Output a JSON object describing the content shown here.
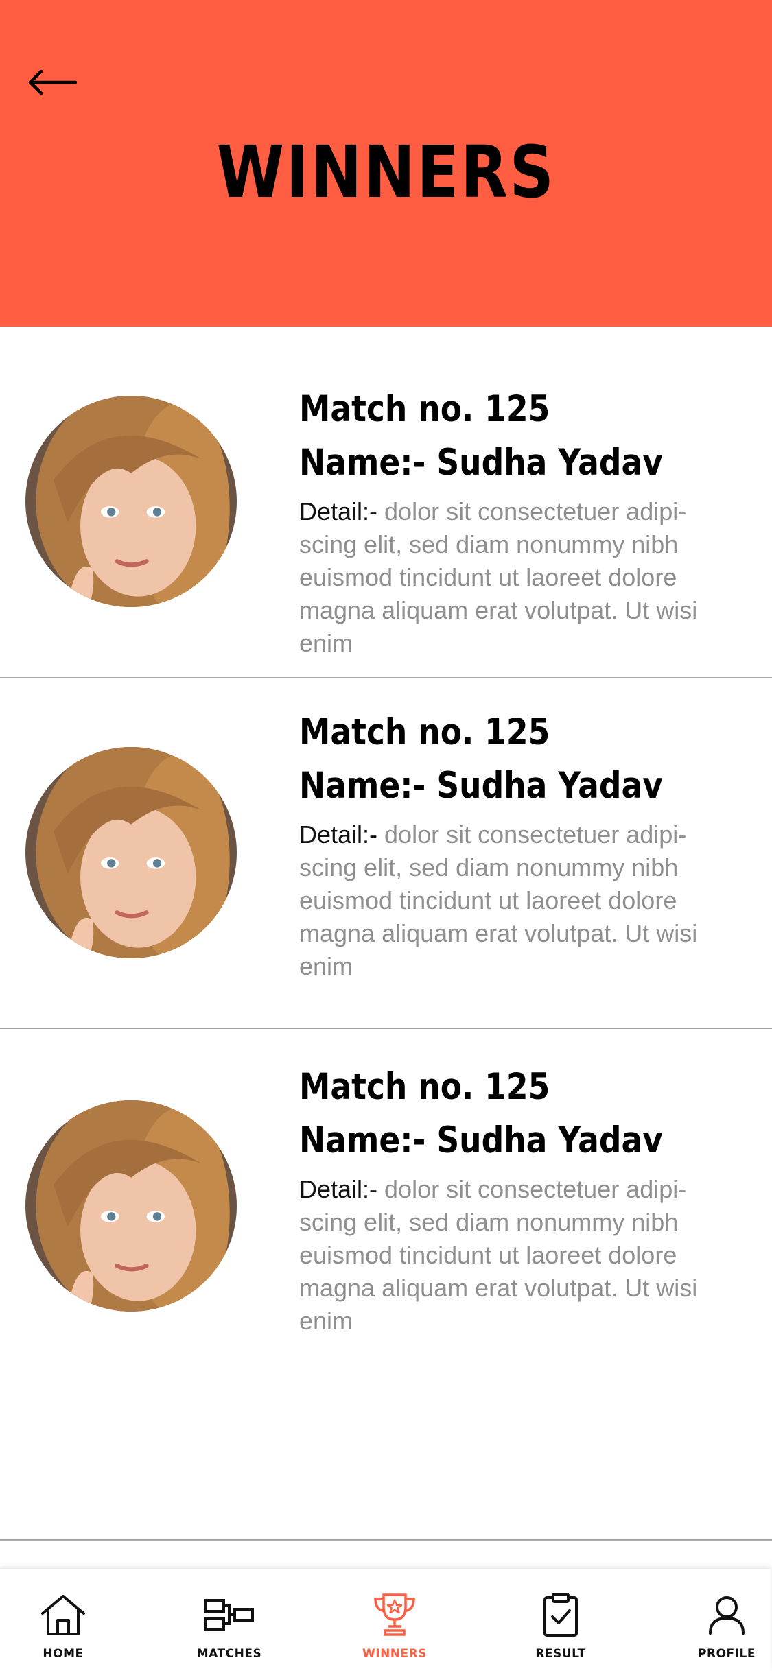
{
  "header": {
    "title": "WINNERS",
    "back_icon": "arrow-left-icon",
    "background_color": "#ff5e42"
  },
  "winners": [
    {
      "match": "Match no. 125",
      "name": "Name:- Sudha Yadav",
      "detail_label": "Detail:-",
      "detail_text": " dolor sit consectetuer adipi-scing elit, sed diam nonummy nibh euismod tincidunt ut laoreet dolore magna aliquam erat volutpat. Ut wisi enim"
    },
    {
      "match": "Match no. 125",
      "name": "Name:- Sudha Yadav",
      "detail_label": "Detail:-",
      "detail_text": " dolor sit consectetuer adipi-scing elit, sed diam nonummy nibh euismod tincidunt ut laoreet dolore magna aliquam erat volutpat. Ut wisi enim"
    },
    {
      "match": "Match no. 125",
      "name": "Name:- Sudha Yadav",
      "detail_label": "Detail:-",
      "detail_text": " dolor sit consectetuer adipi-scing elit, sed diam nonummy nibh euismod tincidunt ut laoreet dolore magna aliquam erat volutpat. Ut wisi enim"
    }
  ],
  "tabbar": {
    "active": "winners",
    "active_color": "#ff5e42",
    "items": [
      {
        "id": "home",
        "label": "HOME",
        "icon": "home-icon"
      },
      {
        "id": "matches",
        "label": "MATCHES",
        "icon": "matches-icon"
      },
      {
        "id": "winners",
        "label": "WINNERS",
        "icon": "trophy-icon"
      },
      {
        "id": "result",
        "label": "RESULT",
        "icon": "clipboard-check-icon"
      },
      {
        "id": "profile",
        "label": "PROFILE",
        "icon": "user-icon"
      }
    ]
  }
}
